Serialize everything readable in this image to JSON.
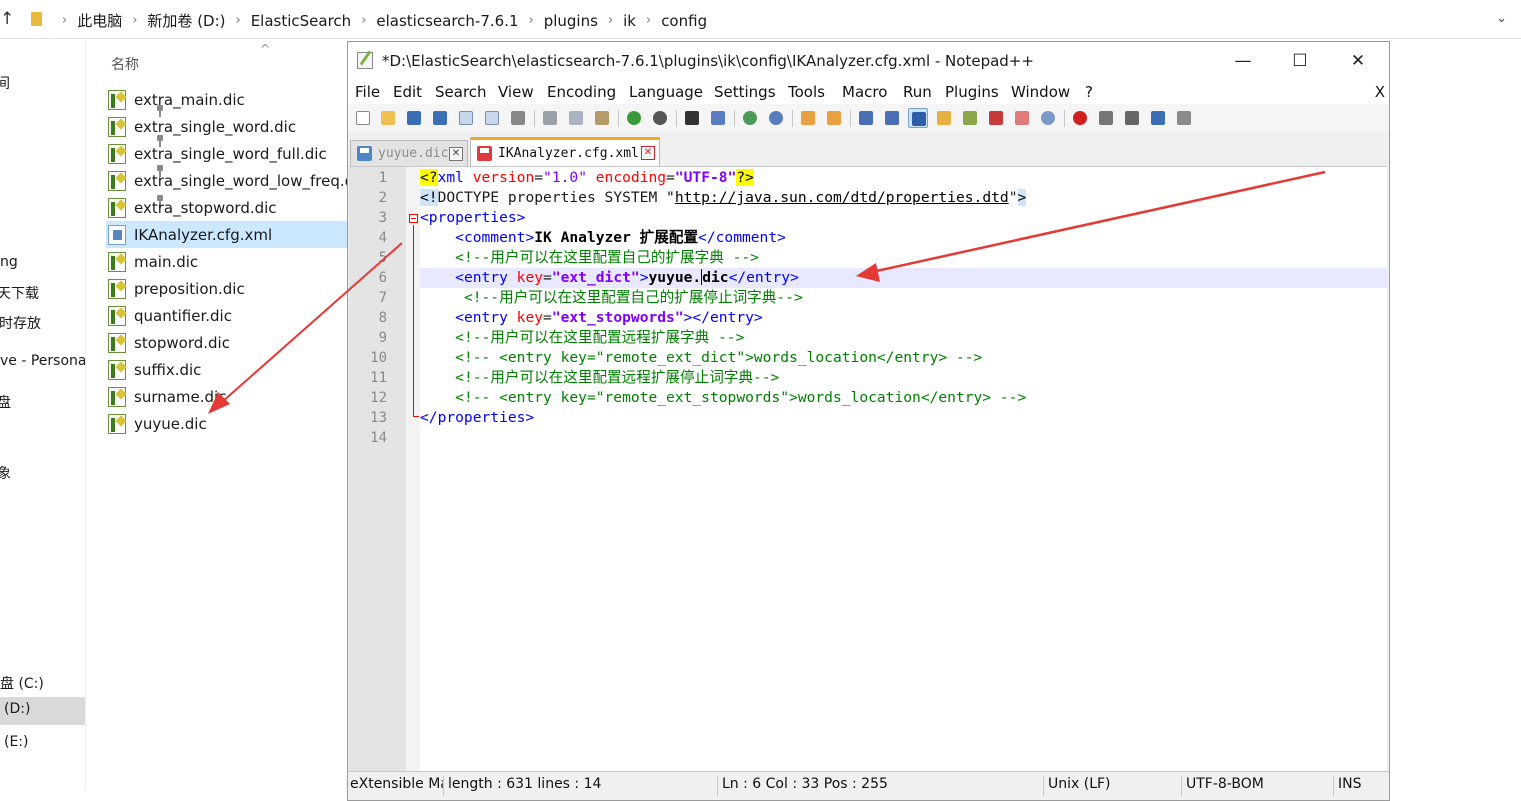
{
  "explorer": {
    "breadcrumb": [
      "此电脑",
      "新加卷 (D:)",
      "ElasticSearch",
      "elasticsearch-7.6.1",
      "plugins",
      "ik",
      "config"
    ],
    "column_header": "名称",
    "files": [
      {
        "name": "extra_main.dic",
        "type": "dic"
      },
      {
        "name": "extra_single_word.dic",
        "type": "dic"
      },
      {
        "name": "extra_single_word_full.dic",
        "type": "dic"
      },
      {
        "name": "extra_single_word_low_freq.dic",
        "type": "dic"
      },
      {
        "name": "extra_stopword.dic",
        "type": "dic"
      },
      {
        "name": "IKAnalyzer.cfg.xml",
        "type": "xml",
        "selected": true
      },
      {
        "name": "main.dic",
        "type": "dic"
      },
      {
        "name": "preposition.dic",
        "type": "dic"
      },
      {
        "name": "quantifier.dic",
        "type": "dic"
      },
      {
        "name": "stopword.dic",
        "type": "dic"
      },
      {
        "name": "suffix.dic",
        "type": "dic"
      },
      {
        "name": "surname.dic",
        "type": "dic"
      },
      {
        "name": "yuyue.dic",
        "type": "dic"
      }
    ],
    "nav_items": [
      "间",
      "ng",
      "天下载",
      "时存放",
      "ve - Persona",
      "盘",
      "象",
      "盘 (C:)",
      "(D:)",
      "(E:)"
    ]
  },
  "npp": {
    "title": "*D:\\ElasticSearch\\elasticsearch-7.6.1\\plugins\\ik\\config\\IKAnalyzer.cfg.xml - Notepad++",
    "menu": [
      "File",
      "Edit",
      "Search",
      "View",
      "Encoding",
      "Language",
      "Settings",
      "Tools",
      "Macro",
      "Run",
      "Plugins",
      "Window",
      "?"
    ],
    "close_doc": "X",
    "tabs": [
      {
        "label": "yuyue.dic",
        "active": false
      },
      {
        "label": "IKAnalyzer.cfg.xml",
        "active": true
      }
    ],
    "line_numbers": [
      "1",
      "2",
      "3",
      "4",
      "5",
      "6",
      "7",
      "8",
      "9",
      "10",
      "11",
      "12",
      "13",
      "14"
    ],
    "status": {
      "lang": "eXtensible Markup Language file",
      "length": "length : 631    lines : 14",
      "pos": "Ln : 6    Col : 33    Pos : 255",
      "eol": "Unix (LF)",
      "enc": "UTF-8-BOM",
      "mode": "INS"
    }
  },
  "code": {
    "l1": [
      "<",
      "?",
      "xml",
      " version",
      "=",
      "\"1.0\"",
      " encoding",
      "=",
      "\"UTF-8\"",
      "?>"
    ],
    "l2": [
      "<",
      "!",
      "DOCTYPE properties SYSTEM \"",
      "http://java.sun.com/dtd/properties.dtd",
      "\"",
      ">"
    ],
    "l3": [
      "<properties>"
    ],
    "l4": [
      "    ",
      "<comment>",
      "IK Analyzer 扩展配置",
      "</comment>"
    ],
    "l5": [
      "    ",
      "<!--用户可以在这里配置自己的扩展字典 -->"
    ],
    "l6": [
      "    ",
      "<entry",
      " key",
      "=",
      "\"ext_dict\"",
      ">",
      "yuyue.",
      "dic",
      "</entry>"
    ],
    "l7": [
      "     ",
      "<!--用户可以在这里配置自己的扩展停止词字典-->"
    ],
    "l8": [
      "    ",
      "<entry",
      " key",
      "=",
      "\"ext_stopwords\"",
      "></entry>"
    ],
    "l9": [
      "    ",
      "<!--用户可以在这里配置远程扩展字典 -->"
    ],
    "l10": [
      "    ",
      "<!-- <entry key=\"remote_ext_dict\">words_location</entry> -->"
    ],
    "l11": [
      "    ",
      "<!--用户可以在这里配置远程扩展停止词字典-->"
    ],
    "l12": [
      "    ",
      "<!-- <entry key=\"remote_ext_stopwords\">words_location</entry> -->"
    ],
    "l13": [
      "</properties>"
    ]
  },
  "colors": {
    "tag": "#0000ff",
    "attr": "#ff0000",
    "value": "#8000ff",
    "comment": "#008000",
    "arrow": "#e53935",
    "tab_accent": "#f5a623"
  }
}
